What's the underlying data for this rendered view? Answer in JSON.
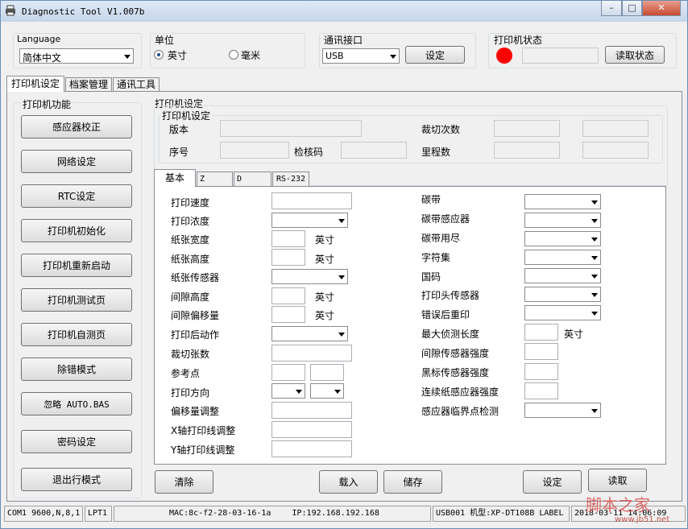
{
  "window": {
    "title": "Diagnostic Tool V1.007b",
    "min_icon": "minimize-icon",
    "max_icon": "maximize-icon",
    "close_icon": "close-icon"
  },
  "top": {
    "language_label": "Language",
    "language_value": "简体中文",
    "unit_label": "单位",
    "unit_inch": "英寸",
    "unit_mm": "毫米",
    "comm_label": "通讯接口",
    "comm_value": "USB",
    "comm_set_button": "设定",
    "status_label": "打印机状态",
    "status_button": "读取状态",
    "status_color": "#ff0000"
  },
  "tabs": [
    "打印机设定",
    "档案管理",
    "通讯工具"
  ],
  "left": {
    "group_title": "打印机功能",
    "buttons": [
      "感应器校正",
      "网络设定",
      "RTC设定",
      "打印机初始化",
      "打印机重新启动",
      "打印机测试页",
      "打印机自测页",
      "除错模式",
      "忽略 AUTO.BAS",
      "密码设定",
      "退出行模式"
    ]
  },
  "settings": {
    "outer_title": "打印机设定",
    "inner_title": "打印机设定",
    "version_label": "版本",
    "serial_label": "序号",
    "checksum_label": "检核码",
    "cut_count_label": "裁切次数",
    "mileage_label": "里程数"
  },
  "subtabs": [
    "基本",
    "Z",
    "D",
    "RS-232"
  ],
  "basic": {
    "left_labels": [
      "打印速度",
      "打印浓度",
      "纸张宽度",
      "纸张高度",
      "纸张传感器",
      "间隙高度",
      "间隙偏移量",
      "打印后动作",
      "裁切张数",
      "参考点",
      "打印方向",
      "偏移量调整",
      "X轴打印线调整",
      "Y轴打印线调整"
    ],
    "unit": "英寸",
    "right_labels": [
      "碳带",
      "碳带感应器",
      "碳带用尽",
      "字符集",
      "国码",
      "打印头传感器",
      "错误后重印",
      "最大侦测长度",
      "间隙传感器强度",
      "黑标传感器强度",
      "连续纸感应器强度",
      "感应器临界点检测"
    ]
  },
  "bottom_buttons": {
    "clear": "清除",
    "load": "载入",
    "save": "储存",
    "set": "设定",
    "read": "读取"
  },
  "statusbar": {
    "com": "COM1 9600,N,8,1",
    "lpt": "LPT1",
    "mac": "MAC:8c-f2-28-03-16-1a",
    "ip": "IP:192.168.192.168",
    "usb": "USB001 机型:XP-DT108B LABEL",
    "time": "2018-03-11 14:06:09"
  },
  "watermark": {
    "text": "脚本之家",
    "url": "www.jb51.net"
  }
}
